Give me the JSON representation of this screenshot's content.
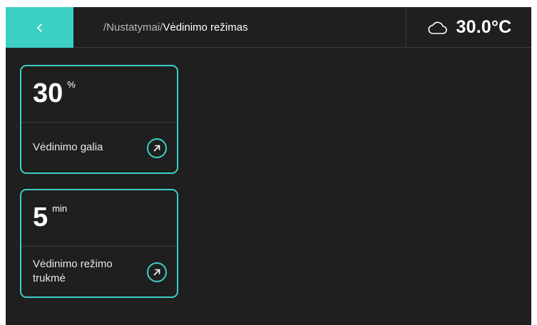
{
  "header": {
    "breadcrumb_parent": "/Nustatymai/",
    "breadcrumb_current": "Vėdinimo režimas",
    "back_icon": "chevron-left-icon"
  },
  "weather": {
    "icon": "cloud-icon",
    "temperature": "30.0°C"
  },
  "cards": [
    {
      "value": "30",
      "unit": "%",
      "label": "Vėdinimo galia",
      "action_icon": "arrow-up-right-icon"
    },
    {
      "value": "5",
      "unit": "min",
      "label": "Vėdinimo režimo trukmė",
      "action_icon": "arrow-up-right-icon"
    }
  ],
  "colors": {
    "accent": "#3ccfc4",
    "background": "#1f1f1f",
    "text": "#ffffff"
  }
}
